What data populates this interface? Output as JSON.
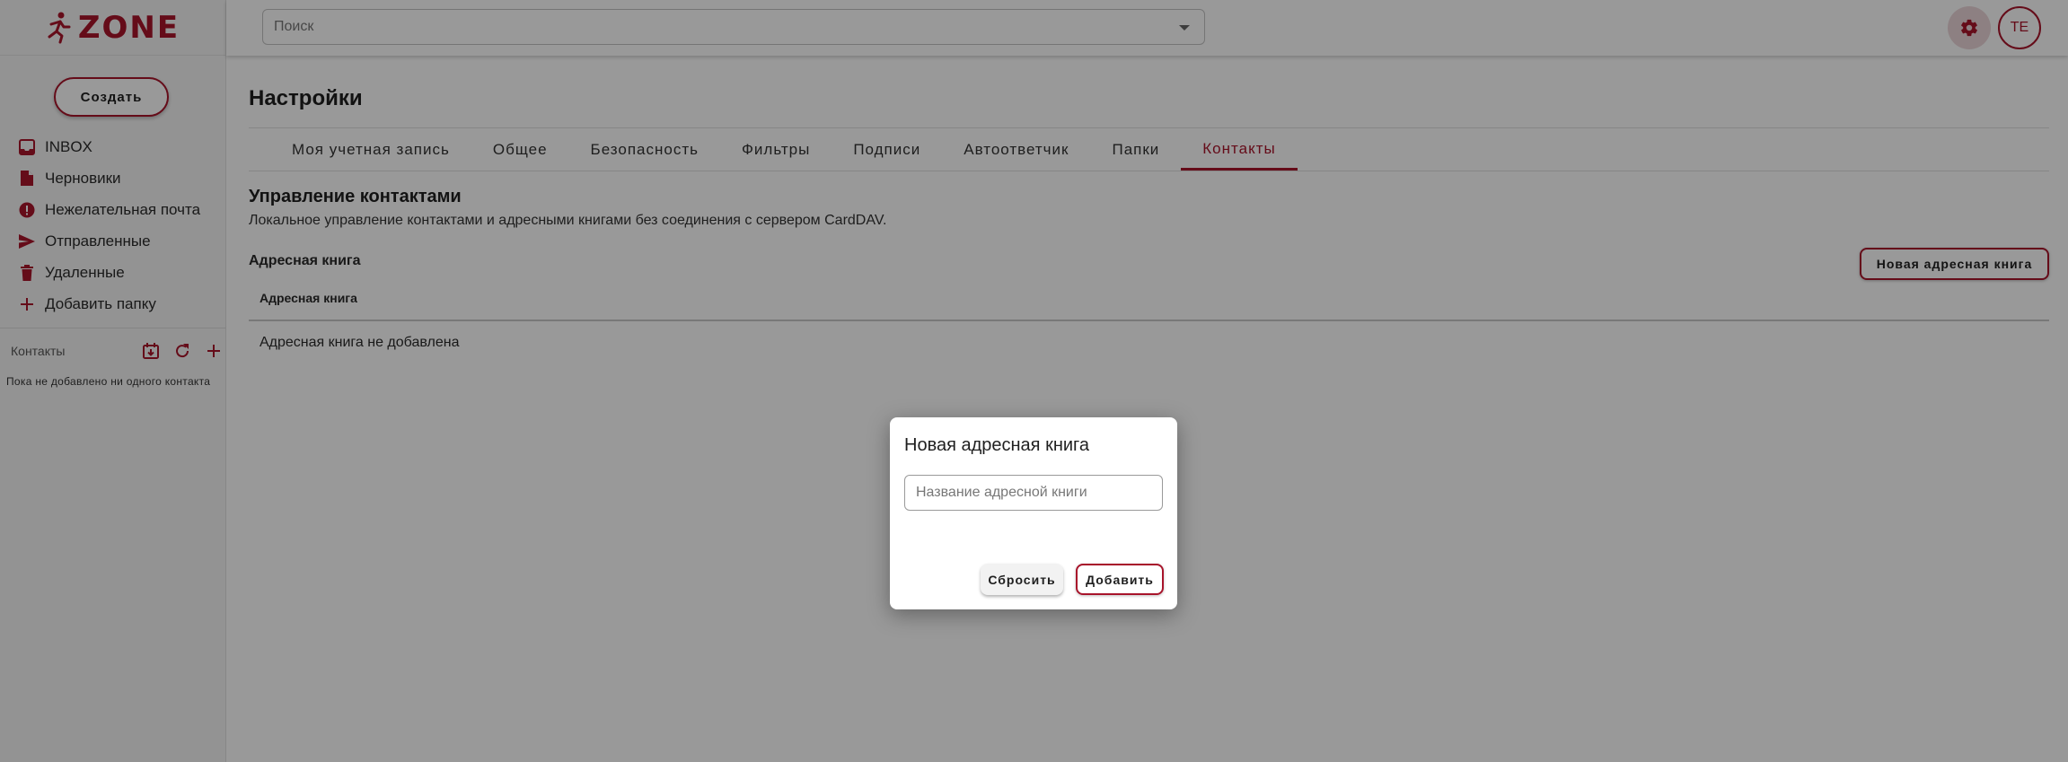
{
  "brand": {
    "logo_text": "ZONE",
    "accent_color": "#a8142b"
  },
  "sidebar": {
    "create_label": "Создать",
    "items": [
      {
        "label": "INBOX",
        "icon": "inbox-icon"
      },
      {
        "label": "Черновики",
        "icon": "draft-icon"
      },
      {
        "label": "Нежелательная почта",
        "icon": "spam-icon"
      },
      {
        "label": "Отправленные",
        "icon": "send-icon"
      },
      {
        "label": "Удаленные",
        "icon": "trash-icon"
      },
      {
        "label": "Добавить папку",
        "icon": "plus-icon"
      }
    ],
    "contacts": {
      "label": "Контакты",
      "empty_text": "Пока не добавлено ни одного контакта",
      "icons": [
        "import-contacts-icon",
        "refresh-icon",
        "add-contact-icon"
      ]
    }
  },
  "header": {
    "search_placeholder": "Поиск",
    "avatar_initials": "TE"
  },
  "main": {
    "title": "Настройки",
    "tabs": [
      {
        "label": "Моя учетная запись"
      },
      {
        "label": "Общее"
      },
      {
        "label": "Безопасность"
      },
      {
        "label": "Фильтры"
      },
      {
        "label": "Подписи"
      },
      {
        "label": "Автоответчик"
      },
      {
        "label": "Папки"
      },
      {
        "label": "Контакты"
      }
    ],
    "active_tab": "Контакты",
    "section_title": "Управление контактами",
    "section_desc": "Локальное управление контактами и адресными книгами без соединения с сервером CardDAV.",
    "address_book_label": "Адресная книга",
    "new_address_book_button": "Новая адресная книга",
    "table": {
      "column_header": "Адресная книга",
      "empty_text": "Адресная книга не добавлена"
    }
  },
  "dialog": {
    "title": "Новая адресная книга",
    "input_placeholder": "Название адресной книги",
    "input_value": "",
    "reset_label": "Сбросить",
    "add_label": "Добавить"
  }
}
